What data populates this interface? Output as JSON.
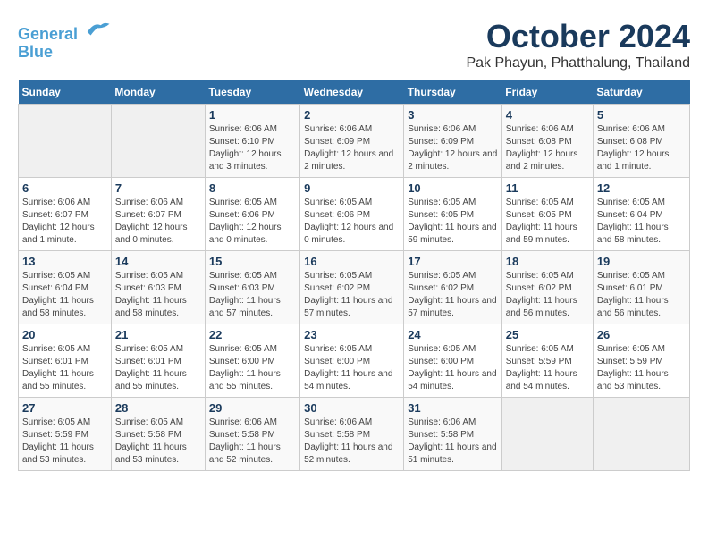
{
  "header": {
    "logo_line1": "General",
    "logo_line2": "Blue",
    "main_title": "October 2024",
    "subtitle": "Pak Phayun, Phatthalung, Thailand"
  },
  "days_of_week": [
    "Sunday",
    "Monday",
    "Tuesday",
    "Wednesday",
    "Thursday",
    "Friday",
    "Saturday"
  ],
  "weeks": [
    [
      {
        "day": "",
        "info": ""
      },
      {
        "day": "",
        "info": ""
      },
      {
        "day": "1",
        "info": "Sunrise: 6:06 AM\nSunset: 6:10 PM\nDaylight: 12 hours and 3 minutes."
      },
      {
        "day": "2",
        "info": "Sunrise: 6:06 AM\nSunset: 6:09 PM\nDaylight: 12 hours and 2 minutes."
      },
      {
        "day": "3",
        "info": "Sunrise: 6:06 AM\nSunset: 6:09 PM\nDaylight: 12 hours and 2 minutes."
      },
      {
        "day": "4",
        "info": "Sunrise: 6:06 AM\nSunset: 6:08 PM\nDaylight: 12 hours and 2 minutes."
      },
      {
        "day": "5",
        "info": "Sunrise: 6:06 AM\nSunset: 6:08 PM\nDaylight: 12 hours and 1 minute."
      }
    ],
    [
      {
        "day": "6",
        "info": "Sunrise: 6:06 AM\nSunset: 6:07 PM\nDaylight: 12 hours and 1 minute."
      },
      {
        "day": "7",
        "info": "Sunrise: 6:06 AM\nSunset: 6:07 PM\nDaylight: 12 hours and 0 minutes."
      },
      {
        "day": "8",
        "info": "Sunrise: 6:05 AM\nSunset: 6:06 PM\nDaylight: 12 hours and 0 minutes."
      },
      {
        "day": "9",
        "info": "Sunrise: 6:05 AM\nSunset: 6:06 PM\nDaylight: 12 hours and 0 minutes."
      },
      {
        "day": "10",
        "info": "Sunrise: 6:05 AM\nSunset: 6:05 PM\nDaylight: 11 hours and 59 minutes."
      },
      {
        "day": "11",
        "info": "Sunrise: 6:05 AM\nSunset: 6:05 PM\nDaylight: 11 hours and 59 minutes."
      },
      {
        "day": "12",
        "info": "Sunrise: 6:05 AM\nSunset: 6:04 PM\nDaylight: 11 hours and 58 minutes."
      }
    ],
    [
      {
        "day": "13",
        "info": "Sunrise: 6:05 AM\nSunset: 6:04 PM\nDaylight: 11 hours and 58 minutes."
      },
      {
        "day": "14",
        "info": "Sunrise: 6:05 AM\nSunset: 6:03 PM\nDaylight: 11 hours and 58 minutes."
      },
      {
        "day": "15",
        "info": "Sunrise: 6:05 AM\nSunset: 6:03 PM\nDaylight: 11 hours and 57 minutes."
      },
      {
        "day": "16",
        "info": "Sunrise: 6:05 AM\nSunset: 6:02 PM\nDaylight: 11 hours and 57 minutes."
      },
      {
        "day": "17",
        "info": "Sunrise: 6:05 AM\nSunset: 6:02 PM\nDaylight: 11 hours and 57 minutes."
      },
      {
        "day": "18",
        "info": "Sunrise: 6:05 AM\nSunset: 6:02 PM\nDaylight: 11 hours and 56 minutes."
      },
      {
        "day": "19",
        "info": "Sunrise: 6:05 AM\nSunset: 6:01 PM\nDaylight: 11 hours and 56 minutes."
      }
    ],
    [
      {
        "day": "20",
        "info": "Sunrise: 6:05 AM\nSunset: 6:01 PM\nDaylight: 11 hours and 55 minutes."
      },
      {
        "day": "21",
        "info": "Sunrise: 6:05 AM\nSunset: 6:01 PM\nDaylight: 11 hours and 55 minutes."
      },
      {
        "day": "22",
        "info": "Sunrise: 6:05 AM\nSunset: 6:00 PM\nDaylight: 11 hours and 55 minutes."
      },
      {
        "day": "23",
        "info": "Sunrise: 6:05 AM\nSunset: 6:00 PM\nDaylight: 11 hours and 54 minutes."
      },
      {
        "day": "24",
        "info": "Sunrise: 6:05 AM\nSunset: 6:00 PM\nDaylight: 11 hours and 54 minutes."
      },
      {
        "day": "25",
        "info": "Sunrise: 6:05 AM\nSunset: 5:59 PM\nDaylight: 11 hours and 54 minutes."
      },
      {
        "day": "26",
        "info": "Sunrise: 6:05 AM\nSunset: 5:59 PM\nDaylight: 11 hours and 53 minutes."
      }
    ],
    [
      {
        "day": "27",
        "info": "Sunrise: 6:05 AM\nSunset: 5:59 PM\nDaylight: 11 hours and 53 minutes."
      },
      {
        "day": "28",
        "info": "Sunrise: 6:05 AM\nSunset: 5:58 PM\nDaylight: 11 hours and 53 minutes."
      },
      {
        "day": "29",
        "info": "Sunrise: 6:06 AM\nSunset: 5:58 PM\nDaylight: 11 hours and 52 minutes."
      },
      {
        "day": "30",
        "info": "Sunrise: 6:06 AM\nSunset: 5:58 PM\nDaylight: 11 hours and 52 minutes."
      },
      {
        "day": "31",
        "info": "Sunrise: 6:06 AM\nSunset: 5:58 PM\nDaylight: 11 hours and 51 minutes."
      },
      {
        "day": "",
        "info": ""
      },
      {
        "day": "",
        "info": ""
      }
    ]
  ]
}
